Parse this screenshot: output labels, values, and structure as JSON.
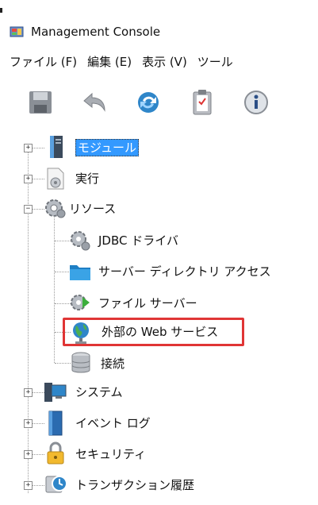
{
  "window": {
    "title": "Management Console"
  },
  "menubar": {
    "items": [
      "ファイル (F)",
      "編集 (E)",
      "表示 (V)",
      "ツール"
    ]
  },
  "toolbar": {
    "buttons": [
      {
        "icon": "save-icon"
      },
      {
        "icon": "undo-icon"
      },
      {
        "icon": "refresh-icon"
      },
      {
        "icon": "clipboard-icon"
      },
      {
        "icon": "info-icon"
      }
    ]
  },
  "tree": {
    "nodes": [
      {
        "label": "モジュール",
        "icon": "module-icon",
        "expander": "+",
        "selected": true
      },
      {
        "label": "実行",
        "icon": "execute-icon",
        "expander": "+"
      },
      {
        "label": "リソース",
        "icon": "resources-icon",
        "expander": "−"
      },
      {
        "label": "JDBC ドライバ",
        "icon": "jdbc-driver-icon"
      },
      {
        "label": "サーバー ディレクトリ アクセス",
        "icon": "folder-icon"
      },
      {
        "label": "ファイル サーバー",
        "icon": "file-server-icon"
      },
      {
        "label": "外部の Web サービス",
        "icon": "globe-icon",
        "highlighted": true
      },
      {
        "label": "接続",
        "icon": "database-icon"
      },
      {
        "label": "システム",
        "icon": "system-icon",
        "expander": "+"
      },
      {
        "label": "イベント ログ",
        "icon": "event-log-icon",
        "expander": "+"
      },
      {
        "label": "セキュリティ",
        "icon": "lock-icon",
        "expander": "+"
      },
      {
        "label": "トランザクション履歴",
        "icon": "transaction-history-icon",
        "expander": "+"
      }
    ]
  },
  "colors": {
    "selection": "#3399ff",
    "highlight_border": "#e03535"
  }
}
